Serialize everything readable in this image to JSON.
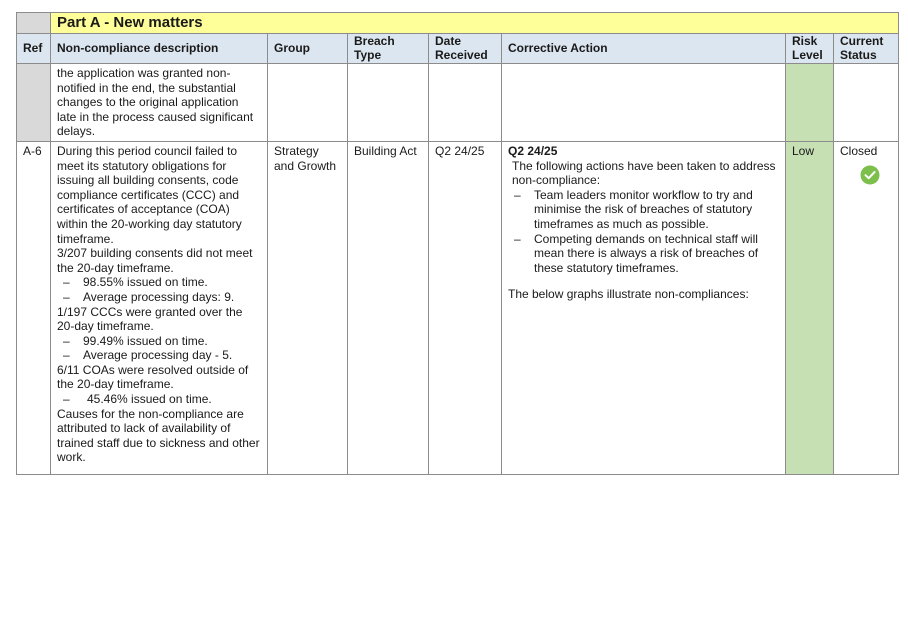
{
  "section_title": "Part A - New matters",
  "headers": {
    "ref": "Ref",
    "description": "Non-compliance description",
    "group": "Group",
    "breach_type": "Breach Type",
    "date_received": "Date Received",
    "corrective_action": "Corrective Action",
    "risk_level": "Risk Level",
    "current_status": "Current Status"
  },
  "continued_row": {
    "description": "the application was granted non-notified in the end, the substantial changes to the original application late in the process caused significant delays."
  },
  "row_a6": {
    "ref": "A-6",
    "description": {
      "intro": "During this period council failed to meet its statutory obligations for issuing all building consents, code compliance certificates (CCC) and certificates of acceptance (COA) within the 20-working day statutory timeframe.",
      "bc_summary": "3/207 building consents did not meet the 20-day timeframe.",
      "bc_points": [
        "98.55% issued on time.",
        "Average processing days: 9."
      ],
      "ccc_summary": "1/197 CCCs were granted over the 20-day timeframe.",
      "ccc_points": [
        "99.49% issued on time.",
        "Average processing day - 5."
      ],
      "coa_summary": "6/11 COAs were resolved outside of the 20-day timeframe.",
      "coa_points": [
        "45.46% issued on time."
      ],
      "causes": "Causes for the non-compliance are attributed to lack of availability of trained staff due to sickness and other work."
    },
    "group": "Strategy and Growth",
    "breach_type": "Building Act",
    "date_received": "Q2 24/25",
    "corrective_action": {
      "period": "Q2 24/25",
      "intro": "The following actions have been taken to address non-compliance:",
      "points": [
        "Team leaders monitor workflow to try and minimise the risk of breaches of statutory timeframes as much as possible.",
        "Competing demands on technical staff will mean there is always a risk of breaches of these statutory timeframes."
      ],
      "footer": "The below graphs illustrate non-compliances:"
    },
    "risk_level": "Low",
    "current_status": "Closed",
    "status_icon": "check-circle-icon",
    "status_color": "#7cc04b"
  },
  "colors": {
    "title_bg": "#ffff99",
    "header_bg": "#dce6f0",
    "ref_bg": "#d9d9d9",
    "risk_bg": "#c6e0b4"
  }
}
